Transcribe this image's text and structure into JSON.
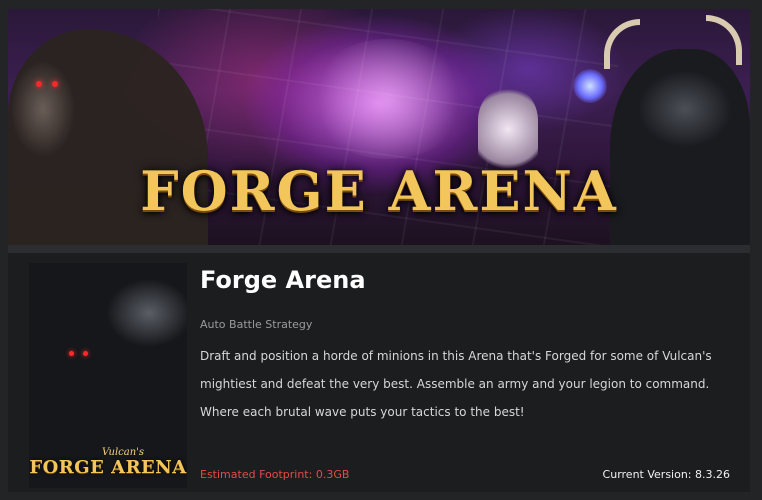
{
  "banner": {
    "logo_text": "FORGE ARENA"
  },
  "cover": {
    "subtitle": "Vulcan's",
    "title": "FORGE ARENA"
  },
  "game": {
    "title": "Forge Arena",
    "genre": "Auto Battle Strategy",
    "description": "Draft and position a horde of minions in this Arena that's Forged for some of Vulcan's mightiest and defeat the very best. Assemble an army and your legion to command. Where each brutal wave puts your tactics to the best!"
  },
  "footer": {
    "footprint": "Estimated Footprint: 0.3GB",
    "version": "Current Version: 8.3.26"
  },
  "colors": {
    "background": "#1c1d1f",
    "accent_gold": "#f2c65a",
    "footprint_red": "#e24b4b",
    "genre_gray": "#9a9b9e"
  }
}
